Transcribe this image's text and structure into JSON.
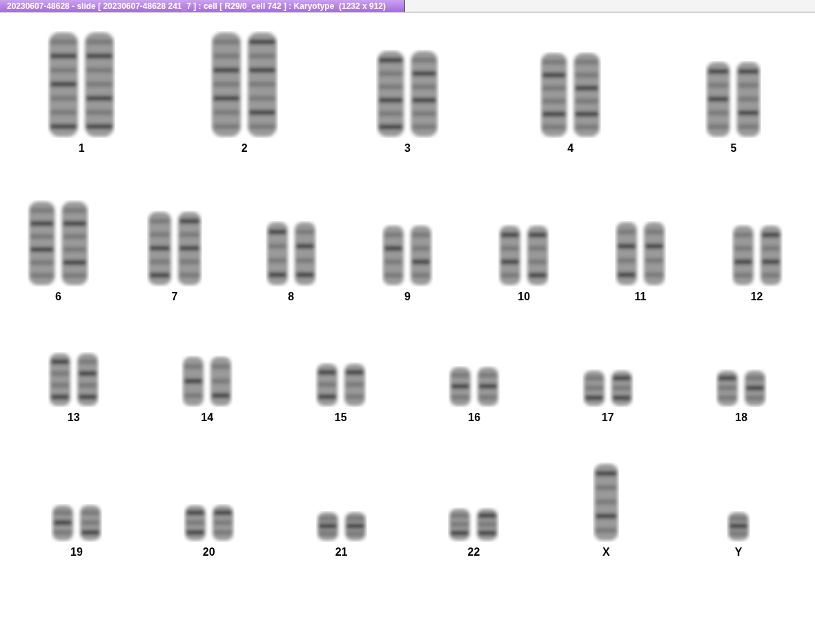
{
  "window": {
    "title": "20230607-48628 - slide [ 20230607-48628 241_7 ] : cell [ R29/0_cell 742 ] : Karyotype  (1232 x 912)"
  },
  "karyotype": {
    "rows": [
      {
        "chromosomes": [
          {
            "label": "1",
            "kind": "pair"
          },
          {
            "label": "2",
            "kind": "pair"
          },
          {
            "label": "3",
            "kind": "pair"
          },
          {
            "label": "4",
            "kind": "pair"
          },
          {
            "label": "5",
            "kind": "pair"
          }
        ]
      },
      {
        "chromosomes": [
          {
            "label": "6",
            "kind": "pair"
          },
          {
            "label": "7",
            "kind": "pair"
          },
          {
            "label": "8",
            "kind": "pair"
          },
          {
            "label": "9",
            "kind": "pair"
          },
          {
            "label": "10",
            "kind": "pair"
          },
          {
            "label": "11",
            "kind": "pair"
          },
          {
            "label": "12",
            "kind": "pair"
          }
        ]
      },
      {
        "chromosomes": [
          {
            "label": "13",
            "kind": "pair"
          },
          {
            "label": "14",
            "kind": "pair"
          },
          {
            "label": "15",
            "kind": "pair"
          },
          {
            "label": "16",
            "kind": "pair"
          },
          {
            "label": "17",
            "kind": "pair"
          },
          {
            "label": "18",
            "kind": "pair"
          }
        ]
      },
      {
        "chromosomes": [
          {
            "label": "19",
            "kind": "pair"
          },
          {
            "label": "20",
            "kind": "pair"
          },
          {
            "label": "21",
            "kind": "pair"
          },
          {
            "label": "22",
            "kind": "pair"
          },
          {
            "label": "X",
            "kind": "single"
          },
          {
            "label": "Y",
            "kind": "single"
          }
        ]
      }
    ]
  }
}
